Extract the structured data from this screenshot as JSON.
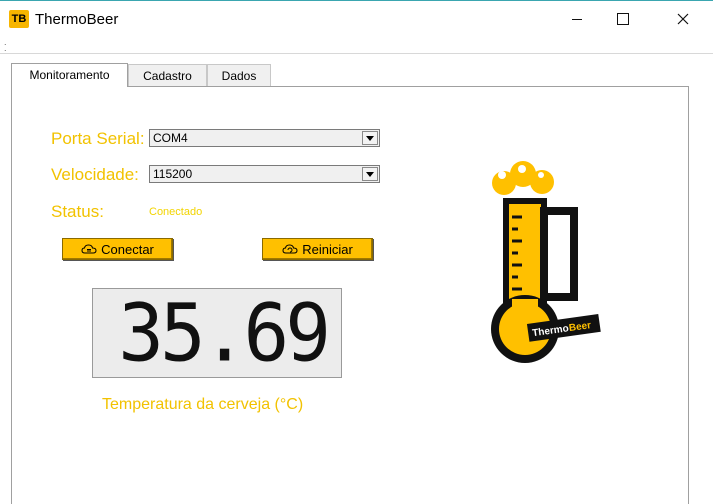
{
  "window": {
    "icon_text": "TB",
    "title": "ThermoBeer"
  },
  "tabs": [
    {
      "label": "Monitoramento",
      "active": true
    },
    {
      "label": "Cadastro",
      "active": false
    },
    {
      "label": "Dados",
      "active": false
    }
  ],
  "form": {
    "porta_label": "Porta Serial:",
    "porta_value": "COM4",
    "velocidade_label": "Velocidade:",
    "velocidade_value": "115200",
    "status_label": "Status:",
    "status_value": "Conectado"
  },
  "buttons": {
    "conectar": "Conectar",
    "reiniciar": "Reiniciar"
  },
  "display": {
    "temperature": "35.69",
    "caption": "Temperatura da cerveja (°C)"
  },
  "logo": {
    "text_thermo": "Thermo",
    "text_beer": "Beer"
  },
  "colors": {
    "accent": "#ffc000",
    "label": "#f2c200",
    "status": "#f2d400"
  }
}
